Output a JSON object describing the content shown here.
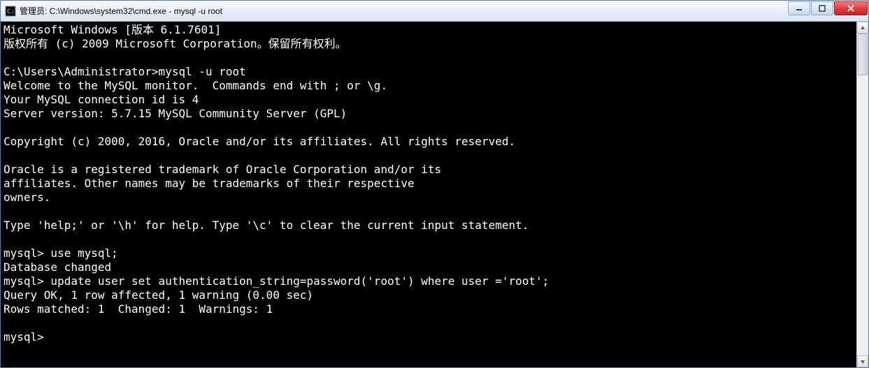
{
  "window": {
    "title": "管理员: C:\\Windows\\system32\\cmd.exe - mysql  -u root"
  },
  "terminal": {
    "lines": [
      "Microsoft Windows [版本 6.1.7601]",
      "版权所有 (c) 2009 Microsoft Corporation。保留所有权利。",
      "",
      "C:\\Users\\Administrator>mysql -u root",
      "Welcome to the MySQL monitor.  Commands end with ; or \\g.",
      "Your MySQL connection id is 4",
      "Server version: 5.7.15 MySQL Community Server (GPL)",
      "",
      "Copyright (c) 2000, 2016, Oracle and/or its affiliates. All rights reserved.",
      "",
      "Oracle is a registered trademark of Oracle Corporation and/or its",
      "affiliates. Other names may be trademarks of their respective",
      "owners.",
      "",
      "Type 'help;' or '\\h' for help. Type '\\c' to clear the current input statement.",
      "",
      "mysql> use mysql;",
      "Database changed",
      "mysql> update user set authentication_string=password('root') where user ='root';",
      "Query OK, 1 row affected, 1 warning (0.00 sec)",
      "Rows matched: 1  Changed: 1  Warnings: 1",
      "",
      "mysql>"
    ]
  }
}
